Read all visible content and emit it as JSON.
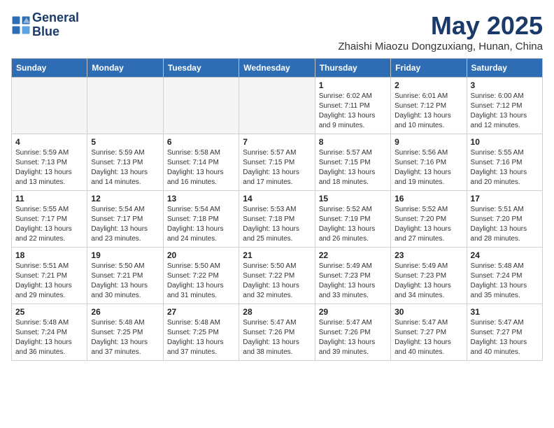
{
  "logo": {
    "line1": "General",
    "line2": "Blue"
  },
  "title": "May 2025",
  "location": "Zhaishi Miaozu Dongzuxiang, Hunan, China",
  "days_of_week": [
    "Sunday",
    "Monday",
    "Tuesday",
    "Wednesday",
    "Thursday",
    "Friday",
    "Saturday"
  ],
  "weeks": [
    [
      {
        "day": "",
        "info": ""
      },
      {
        "day": "",
        "info": ""
      },
      {
        "day": "",
        "info": ""
      },
      {
        "day": "",
        "info": ""
      },
      {
        "day": "1",
        "info": "Sunrise: 6:02 AM\nSunset: 7:11 PM\nDaylight: 13 hours and 9 minutes."
      },
      {
        "day": "2",
        "info": "Sunrise: 6:01 AM\nSunset: 7:12 PM\nDaylight: 13 hours and 10 minutes."
      },
      {
        "day": "3",
        "info": "Sunrise: 6:00 AM\nSunset: 7:12 PM\nDaylight: 13 hours and 12 minutes."
      }
    ],
    [
      {
        "day": "4",
        "info": "Sunrise: 5:59 AM\nSunset: 7:13 PM\nDaylight: 13 hours and 13 minutes."
      },
      {
        "day": "5",
        "info": "Sunrise: 5:59 AM\nSunset: 7:13 PM\nDaylight: 13 hours and 14 minutes."
      },
      {
        "day": "6",
        "info": "Sunrise: 5:58 AM\nSunset: 7:14 PM\nDaylight: 13 hours and 16 minutes."
      },
      {
        "day": "7",
        "info": "Sunrise: 5:57 AM\nSunset: 7:15 PM\nDaylight: 13 hours and 17 minutes."
      },
      {
        "day": "8",
        "info": "Sunrise: 5:57 AM\nSunset: 7:15 PM\nDaylight: 13 hours and 18 minutes."
      },
      {
        "day": "9",
        "info": "Sunrise: 5:56 AM\nSunset: 7:16 PM\nDaylight: 13 hours and 19 minutes."
      },
      {
        "day": "10",
        "info": "Sunrise: 5:55 AM\nSunset: 7:16 PM\nDaylight: 13 hours and 20 minutes."
      }
    ],
    [
      {
        "day": "11",
        "info": "Sunrise: 5:55 AM\nSunset: 7:17 PM\nDaylight: 13 hours and 22 minutes."
      },
      {
        "day": "12",
        "info": "Sunrise: 5:54 AM\nSunset: 7:17 PM\nDaylight: 13 hours and 23 minutes."
      },
      {
        "day": "13",
        "info": "Sunrise: 5:54 AM\nSunset: 7:18 PM\nDaylight: 13 hours and 24 minutes."
      },
      {
        "day": "14",
        "info": "Sunrise: 5:53 AM\nSunset: 7:18 PM\nDaylight: 13 hours and 25 minutes."
      },
      {
        "day": "15",
        "info": "Sunrise: 5:52 AM\nSunset: 7:19 PM\nDaylight: 13 hours and 26 minutes."
      },
      {
        "day": "16",
        "info": "Sunrise: 5:52 AM\nSunset: 7:20 PM\nDaylight: 13 hours and 27 minutes."
      },
      {
        "day": "17",
        "info": "Sunrise: 5:51 AM\nSunset: 7:20 PM\nDaylight: 13 hours and 28 minutes."
      }
    ],
    [
      {
        "day": "18",
        "info": "Sunrise: 5:51 AM\nSunset: 7:21 PM\nDaylight: 13 hours and 29 minutes."
      },
      {
        "day": "19",
        "info": "Sunrise: 5:50 AM\nSunset: 7:21 PM\nDaylight: 13 hours and 30 minutes."
      },
      {
        "day": "20",
        "info": "Sunrise: 5:50 AM\nSunset: 7:22 PM\nDaylight: 13 hours and 31 minutes."
      },
      {
        "day": "21",
        "info": "Sunrise: 5:50 AM\nSunset: 7:22 PM\nDaylight: 13 hours and 32 minutes."
      },
      {
        "day": "22",
        "info": "Sunrise: 5:49 AM\nSunset: 7:23 PM\nDaylight: 13 hours and 33 minutes."
      },
      {
        "day": "23",
        "info": "Sunrise: 5:49 AM\nSunset: 7:23 PM\nDaylight: 13 hours and 34 minutes."
      },
      {
        "day": "24",
        "info": "Sunrise: 5:48 AM\nSunset: 7:24 PM\nDaylight: 13 hours and 35 minutes."
      }
    ],
    [
      {
        "day": "25",
        "info": "Sunrise: 5:48 AM\nSunset: 7:24 PM\nDaylight: 13 hours and 36 minutes."
      },
      {
        "day": "26",
        "info": "Sunrise: 5:48 AM\nSunset: 7:25 PM\nDaylight: 13 hours and 37 minutes."
      },
      {
        "day": "27",
        "info": "Sunrise: 5:48 AM\nSunset: 7:25 PM\nDaylight: 13 hours and 37 minutes."
      },
      {
        "day": "28",
        "info": "Sunrise: 5:47 AM\nSunset: 7:26 PM\nDaylight: 13 hours and 38 minutes."
      },
      {
        "day": "29",
        "info": "Sunrise: 5:47 AM\nSunset: 7:26 PM\nDaylight: 13 hours and 39 minutes."
      },
      {
        "day": "30",
        "info": "Sunrise: 5:47 AM\nSunset: 7:27 PM\nDaylight: 13 hours and 40 minutes."
      },
      {
        "day": "31",
        "info": "Sunrise: 5:47 AM\nSunset: 7:27 PM\nDaylight: 13 hours and 40 minutes."
      }
    ]
  ]
}
